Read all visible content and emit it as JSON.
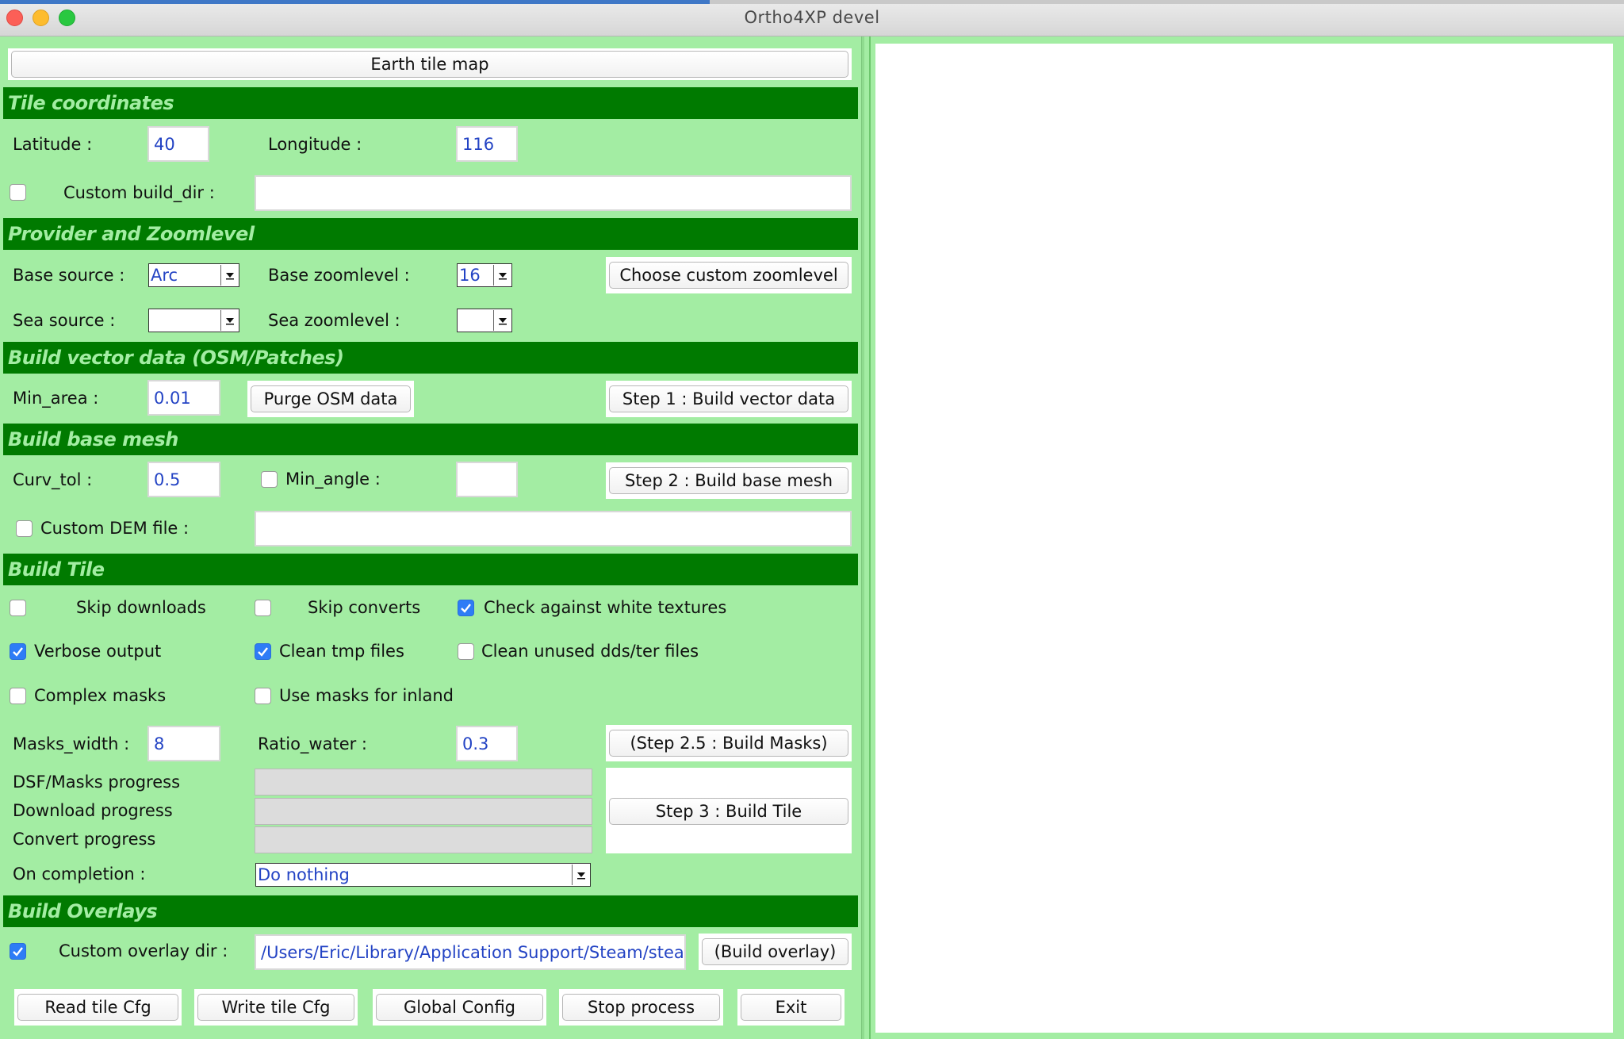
{
  "window": {
    "title": "Ortho4XP  devel"
  },
  "top": {
    "earth_tile_map": "Earth tile map"
  },
  "sections": {
    "tile_coordinates": "Tile coordinates",
    "provider_zoom": "Provider and Zoomlevel",
    "vector": "Build vector data (OSM/Patches)",
    "base_mesh": "Build base mesh",
    "build_tile": "Build Tile",
    "overlays": "Build Overlays"
  },
  "tile": {
    "latitude_label": "Latitude  :",
    "latitude_value": "40",
    "longitude_label": "Longitude  :",
    "longitude_value": "116",
    "custom_build_dir_label": "Custom build_dir  :",
    "custom_build_dir_checked": false,
    "custom_build_dir_value": ""
  },
  "provider": {
    "base_source_label": "Base source  :",
    "base_source_value": "Arc",
    "base_zoom_label": "Base zoomlevel  :",
    "base_zoom_value": "16",
    "choose_custom_zoom": "Choose custom zoomlevel",
    "sea_source_label": "Sea source  :",
    "sea_source_value": "",
    "sea_zoom_label": "Sea zoomlevel  :",
    "sea_zoom_value": ""
  },
  "vector": {
    "min_area_label": "Min_area  :",
    "min_area_value": "0.01",
    "purge_osm": "Purge OSM data",
    "step1": "Step 1 : Build vector data"
  },
  "mesh": {
    "curv_tol_label": "Curv_tol  :",
    "curv_tol_value": "0.5",
    "min_angle_label": "Min_angle :",
    "min_angle_checked": false,
    "min_angle_value": "",
    "step2": "Step 2 : Build base mesh",
    "custom_dem_label": "Custom DEM file :",
    "custom_dem_checked": false,
    "custom_dem_value": ""
  },
  "build": {
    "skip_downloads": "Skip downloads",
    "skip_downloads_checked": false,
    "skip_converts": "Skip converts",
    "skip_converts_checked": false,
    "check_white": "Check against white textures",
    "check_white_checked": true,
    "verbose": "Verbose output",
    "verbose_checked": true,
    "clean_tmp": "Clean tmp files",
    "clean_tmp_checked": true,
    "clean_unused": "Clean unused dds/ter files",
    "clean_unused_checked": false,
    "complex_masks": "Complex masks",
    "complex_masks_checked": false,
    "use_masks_inland": "Use masks for inland",
    "use_masks_inland_checked": false,
    "masks_width_label": "Masks_width :",
    "masks_width_value": "8",
    "ratio_water_label": "Ratio_water :",
    "ratio_water_value": "0.3",
    "step25": "(Step 2.5 : Build Masks)",
    "dsf_progress_label": "DSF/Masks progress",
    "dsf_progress": 0,
    "download_progress_label": "Download progress",
    "download_progress": 0,
    "convert_progress_label": "Convert progress",
    "convert_progress": 0,
    "step3": "Step 3 : Build Tile",
    "on_completion_label": "On completion :",
    "on_completion_value": "Do nothing"
  },
  "overlays": {
    "custom_overlay_label": "Custom overlay dir :",
    "custom_overlay_checked": true,
    "custom_overlay_value": "/Users/Eric/Library/Application Support/Steam/stea",
    "build_overlay": "(Build overlay)"
  },
  "bottom": {
    "read_cfg": "Read tile Cfg",
    "write_cfg": "Write tile Cfg",
    "global_config": "Global Config",
    "stop_process": "Stop process",
    "exit": "Exit"
  }
}
